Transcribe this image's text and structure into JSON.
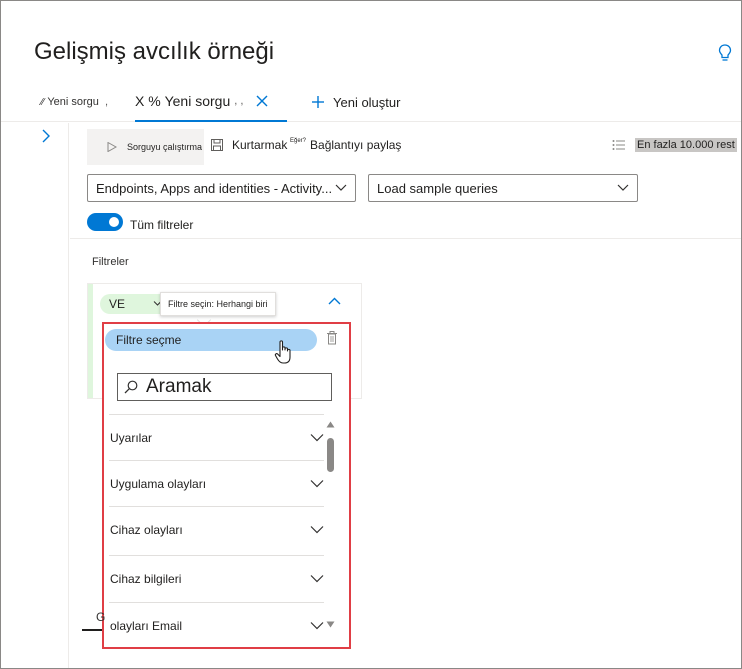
{
  "page": {
    "title": "Gelişmiş avcılık örneği"
  },
  "tabs": {
    "items": [
      {
        "glyph": "∕∕",
        "label": "Yeni sorgu",
        "separator": ","
      },
      {
        "prefix": "X %",
        "label": "Yeni sorgu",
        "trail": ", ,",
        "active": true
      },
      {
        "label": "Yeni oluştur"
      }
    ]
  },
  "toolbar": {
    "run_label": "Sorguyu çalıştırma",
    "save_label": "Kurtarmak",
    "share_sup": "Eğer?",
    "share_label": "Bağlantıyı paylaş",
    "limit_label": "En fazla 10.000 rest"
  },
  "dropdowns": {
    "schema_value": "Endpoints, Apps and identities - Activity...",
    "sample_value": "Load sample queries"
  },
  "filters_toggle": {
    "label": "Tüm filtreler",
    "on": true
  },
  "filters": {
    "heading": "Filtreler",
    "and_label": "VE",
    "tooltip": "Filtre seçin: Herhangi biri",
    "select_label": "Filtre seçme",
    "search_placeholder": "Aramak",
    "items": [
      {
        "label": "Uyarılar"
      },
      {
        "label": "Uygulama olayları"
      },
      {
        "label": "Cihaz olayları"
      },
      {
        "label": "Cihaz bilgileri"
      },
      {
        "label": "olayları Email"
      }
    ]
  },
  "under_panel": {
    "partial": "G"
  },
  "colors": {
    "accent": "#0078d4",
    "highlight_border": "#e03e45",
    "selected_pill": "#a9d3f5",
    "and_pill": "#dff6dd"
  }
}
